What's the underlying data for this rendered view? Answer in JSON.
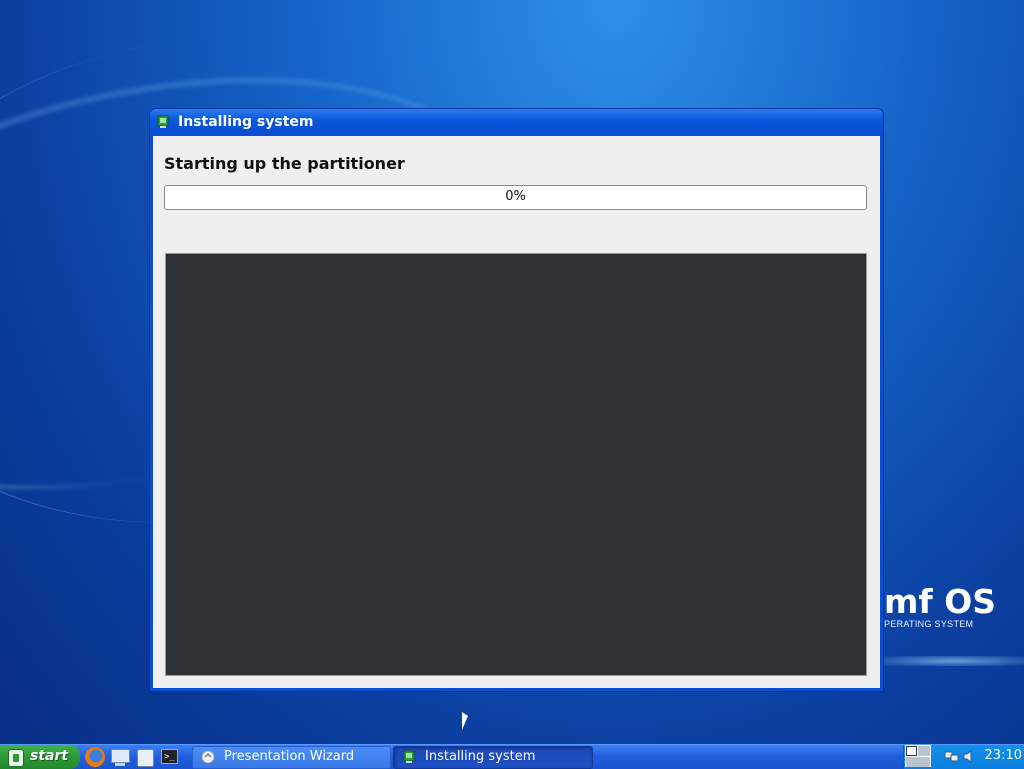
{
  "desktop": {
    "brand_logo": "mf OS",
    "brand_tagline": "PERATING SYSTEM"
  },
  "window": {
    "title": "Installing system",
    "heading": "Starting up the partitioner",
    "progress": {
      "value": 0,
      "label": "0%"
    }
  },
  "taskbar": {
    "start_label": "start",
    "quicklaunch": [
      "firefox-icon",
      "computer-icon",
      "file-manager-icon",
      "terminal-icon"
    ],
    "tasks": [
      {
        "label": "Presentation Wizard",
        "icon": "presentation-wizard-icon",
        "active": false
      },
      {
        "label": "Installing system",
        "icon": "installer-icon",
        "active": true
      }
    ],
    "clock": "23:10"
  },
  "colors": {
    "title_bar": "#0a58de",
    "taskbar": "#1f5fdc",
    "start_button": "#2b9a36",
    "terminal_bg": "#2e3234",
    "window_bg": "#efefef"
  }
}
